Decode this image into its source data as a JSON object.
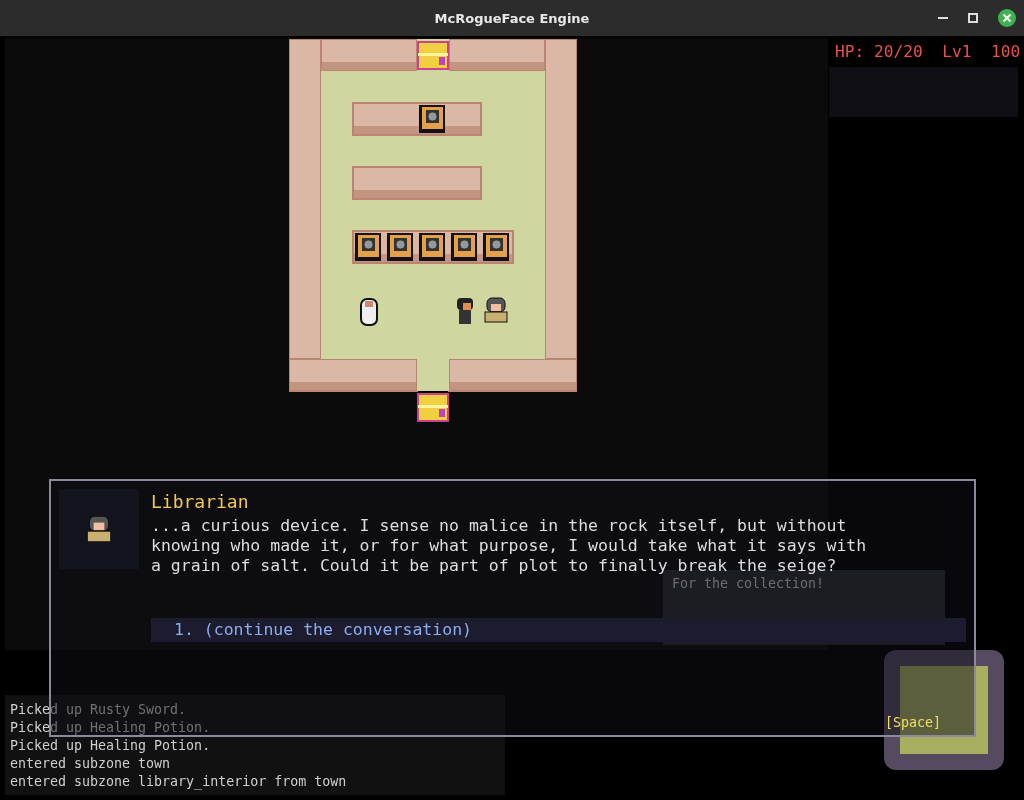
{
  "window": {
    "title": "McRogueFace Engine"
  },
  "hud": {
    "stats": "HP: 20/20  Lv1  100"
  },
  "message_log": {
    "lines": [
      "Picked up Rusty Sword.",
      "Picked up Healing Potion.",
      "Picked up Healing Potion.",
      "entered subzone town",
      "entered subzone library_interior from town"
    ]
  },
  "speech_bubble": {
    "text": "For the collection!"
  },
  "dialog": {
    "speaker": "Librarian",
    "text": "...a curious device. I sense no malice in the rock itself, but without knowing who made it, or for what purpose, I would take what it says with a grain of salt. Could it be part of plot to finally break the seige?",
    "options": [
      {
        "number": "1.",
        "label": "(continue the conversation)",
        "selected": true
      }
    ],
    "hint": "[Space]"
  }
}
